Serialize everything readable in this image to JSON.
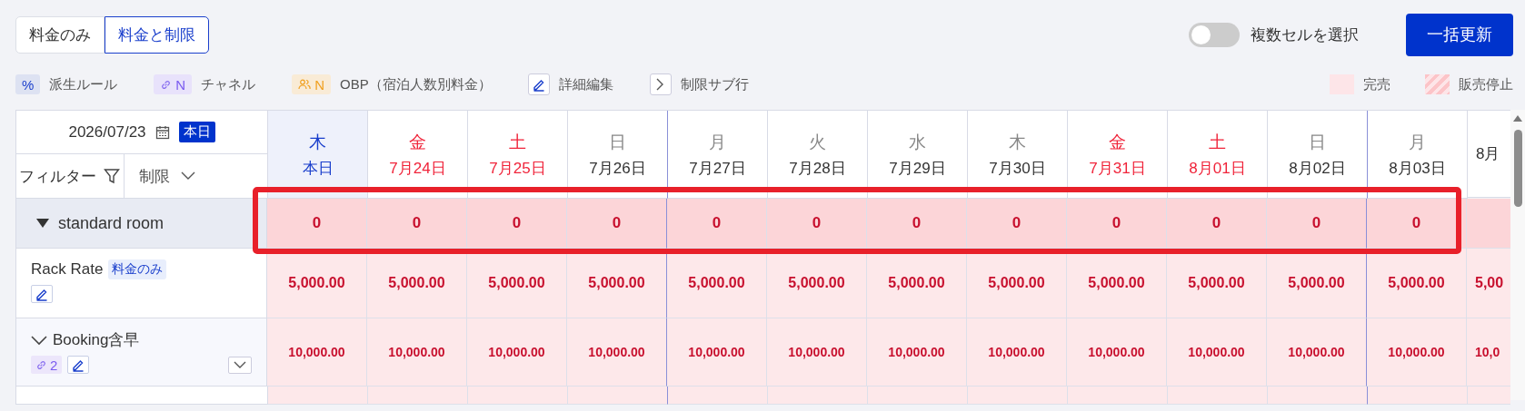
{
  "view_toggle": [
    {
      "label": "料金のみ",
      "selected": false
    },
    {
      "label": "料金と制限",
      "selected": true
    }
  ],
  "multi_select": {
    "label": "複数セルを選択",
    "on": false
  },
  "bulk_update_button": "一括更新",
  "legend": [
    {
      "kind": "derived",
      "badge": "%",
      "label": "派生ルール"
    },
    {
      "kind": "channel",
      "badge": "N",
      "label": "チャネル"
    },
    {
      "kind": "obp",
      "badge": "N",
      "label": "OBP（宿泊人数別料金）"
    },
    {
      "kind": "edit",
      "label": "詳細編集"
    },
    {
      "kind": "sub",
      "label": "制限サブ行"
    },
    {
      "kind": "soldout",
      "label": "完売"
    },
    {
      "kind": "stopsell",
      "label": "販売停止"
    }
  ],
  "grid": {
    "date": "2026/07/23",
    "today_button": "本日",
    "filter": "フィルター",
    "restriction_dropdown": "制限",
    "days": [
      {
        "weekday": "木",
        "date": "本日",
        "kind": "today",
        "week_start": false
      },
      {
        "weekday": "金",
        "date": "7月24日",
        "kind": "holiday",
        "week_start": false
      },
      {
        "weekday": "土",
        "date": "7月25日",
        "kind": "holiday",
        "week_start": false
      },
      {
        "weekday": "日",
        "date": "7月26日",
        "kind": "normal",
        "week_start": false
      },
      {
        "weekday": "月",
        "date": "7月27日",
        "kind": "normal",
        "week_start": true
      },
      {
        "weekday": "火",
        "date": "7月28日",
        "kind": "normal",
        "week_start": false
      },
      {
        "weekday": "水",
        "date": "7月29日",
        "kind": "normal",
        "week_start": false
      },
      {
        "weekday": "木",
        "date": "7月30日",
        "kind": "normal",
        "week_start": false
      },
      {
        "weekday": "金",
        "date": "7月31日",
        "kind": "holiday",
        "week_start": false
      },
      {
        "weekday": "土",
        "date": "8月01日",
        "kind": "holiday",
        "week_start": false
      },
      {
        "weekday": "日",
        "date": "8月02日",
        "kind": "normal",
        "week_start": false
      },
      {
        "weekday": "月",
        "date": "8月03日",
        "kind": "normal",
        "week_start": true
      },
      {
        "date": "8月",
        "kind": "normal",
        "week_start": false
      }
    ],
    "rows": [
      {
        "kind": "group",
        "name": "standard room",
        "expanded": true,
        "values": [
          "0",
          "0",
          "0",
          "0",
          "0",
          "0",
          "0",
          "0",
          "0",
          "0",
          "0",
          "0"
        ]
      },
      {
        "kind": "rate",
        "name": "Rack Rate",
        "tag": "料金のみ",
        "values": [
          "5,000.00",
          "5,000.00",
          "5,000.00",
          "5,000.00",
          "5,000.00",
          "5,000.00",
          "5,000.00",
          "5,000.00",
          "5,000.00",
          "5,000.00",
          "5,000.00",
          "5,000.00",
          "5,00"
        ]
      },
      {
        "kind": "channel_rate",
        "name": "Booking含早",
        "expanded": true,
        "channel_count": "2",
        "values": [
          "10,000.00",
          "10,000.00",
          "10,000.00",
          "10,000.00",
          "10,000.00",
          "10,000.00",
          "10,000.00",
          "10,000.00",
          "10,000.00",
          "10,000.00",
          "10,000.00",
          "10,000.00",
          "10,0"
        ]
      }
    ]
  }
}
